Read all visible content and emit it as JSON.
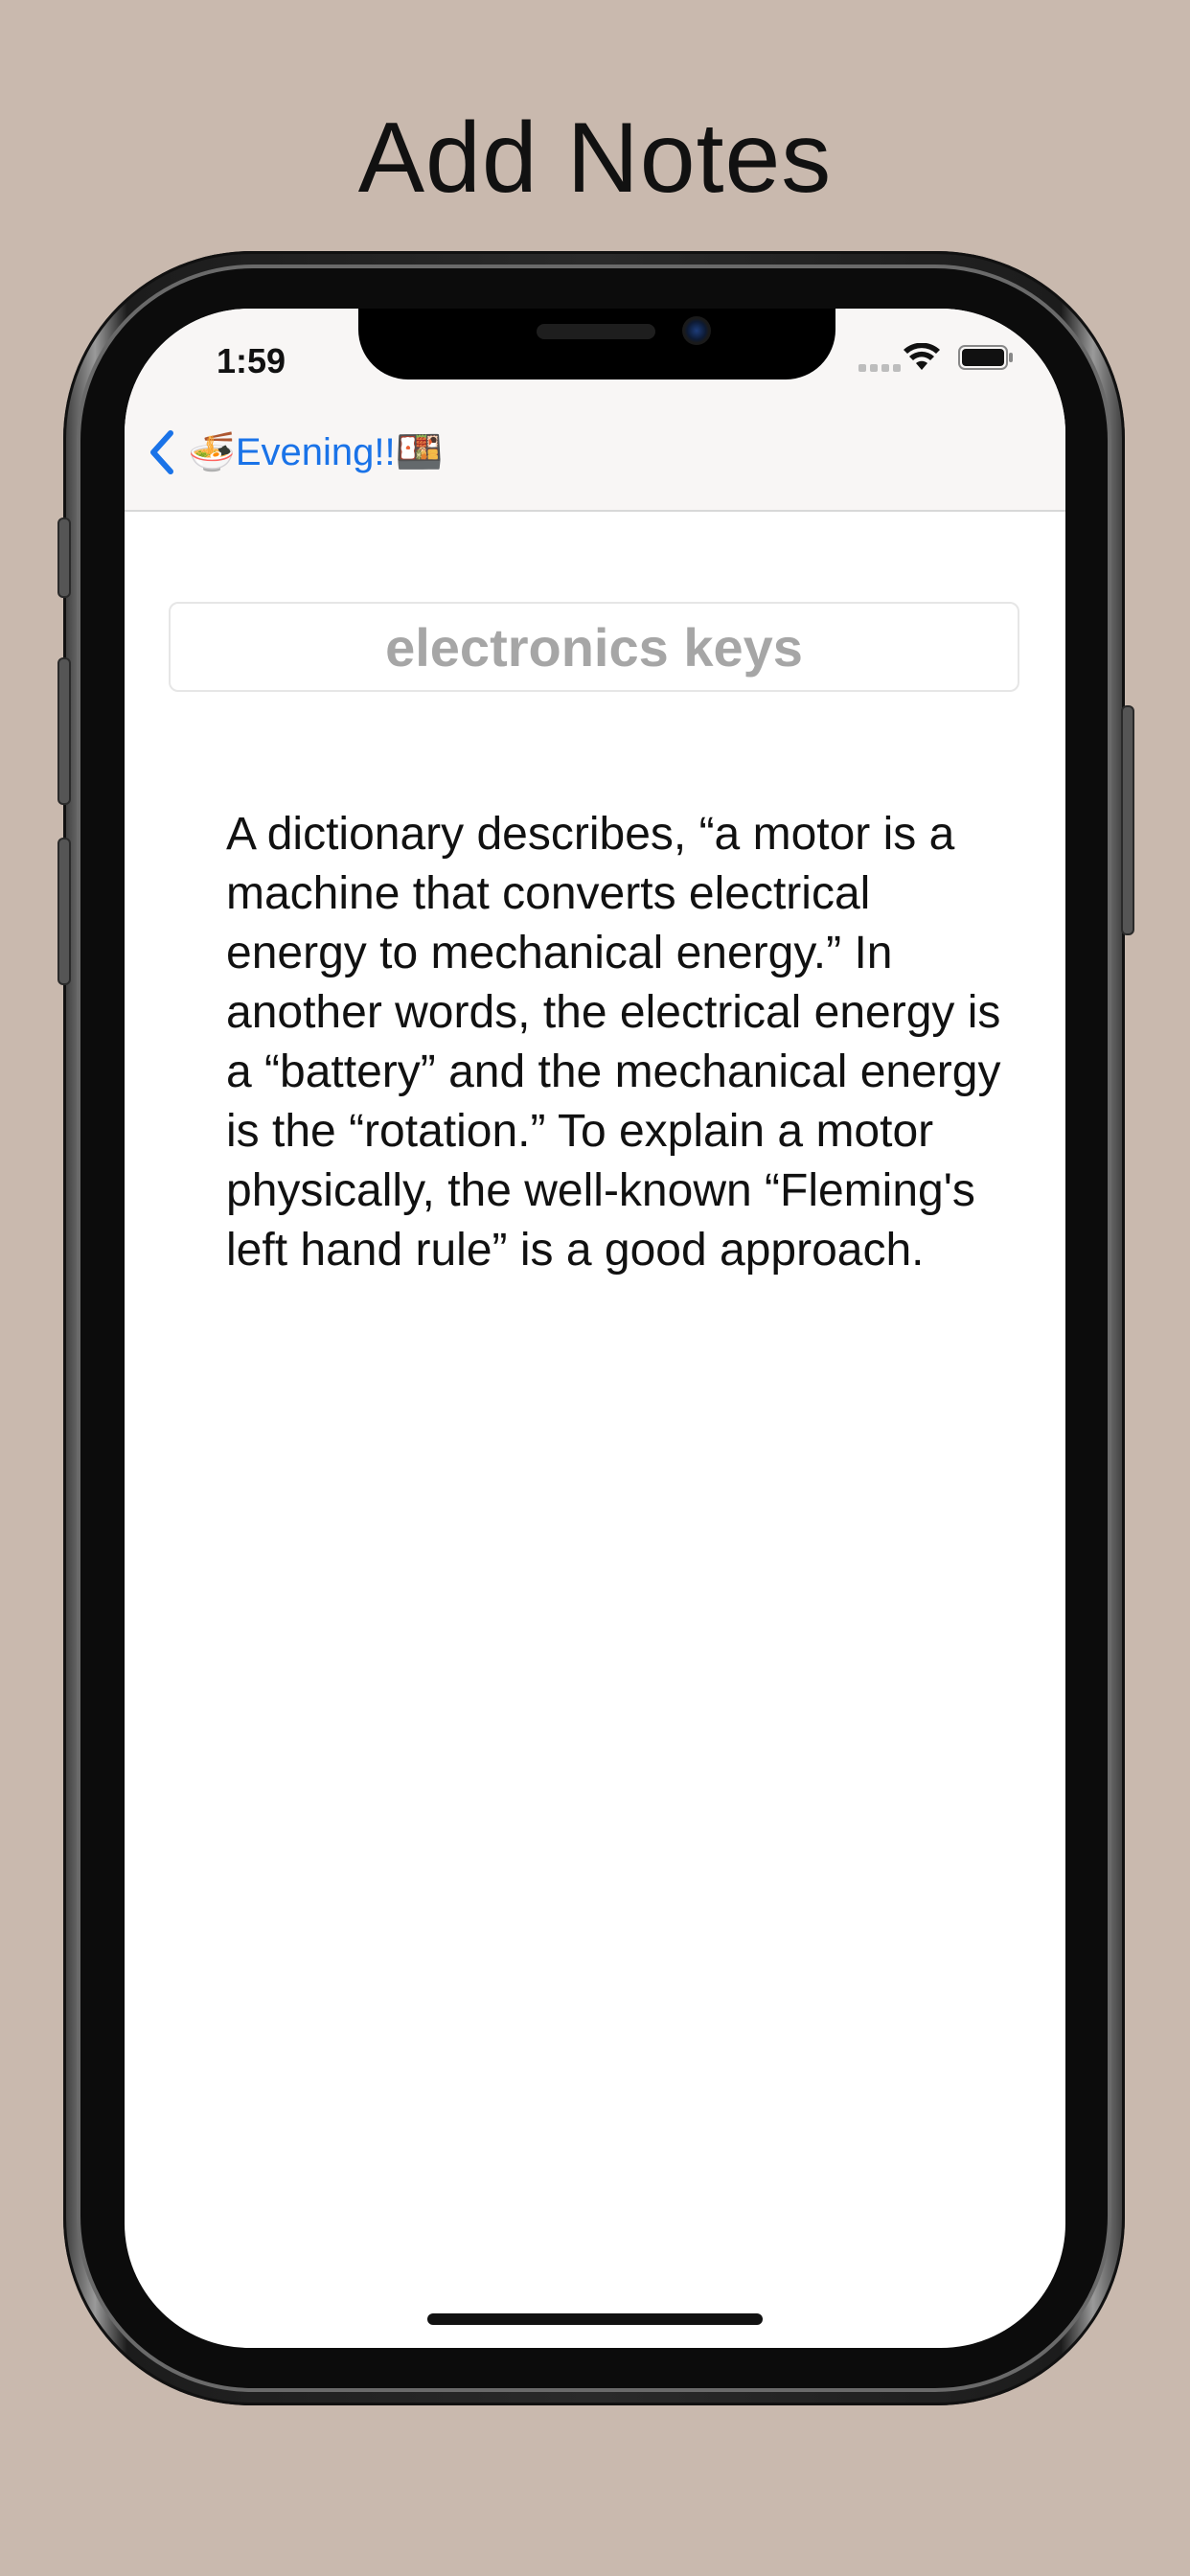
{
  "promo": {
    "title": "Add Notes"
  },
  "status_bar": {
    "time": "1:59",
    "icons": [
      "signal-dots-icon",
      "wifi-icon",
      "battery-icon"
    ]
  },
  "nav": {
    "back_icon": "chevron-left-icon",
    "emoji_left": "🍜",
    "back_label": "Evening!!",
    "emoji_right": "🍱",
    "accent_color": "#1a73e8"
  },
  "note": {
    "title_placeholder": "electronics keys",
    "title_value": "",
    "body": "A dictionary describes, “a motor is a machine that converts electrical energy to mechanical energy.” In another words, the electrical energy is a “battery” and the mechanical energy is the “rotation.” To explain a motor physically, the well-known “Fleming's left hand rule” is a good approach."
  },
  "colors": {
    "background": "#c9b9ae",
    "nav_background": "#f8f6f5",
    "placeholder_text": "#a6a6a6"
  }
}
